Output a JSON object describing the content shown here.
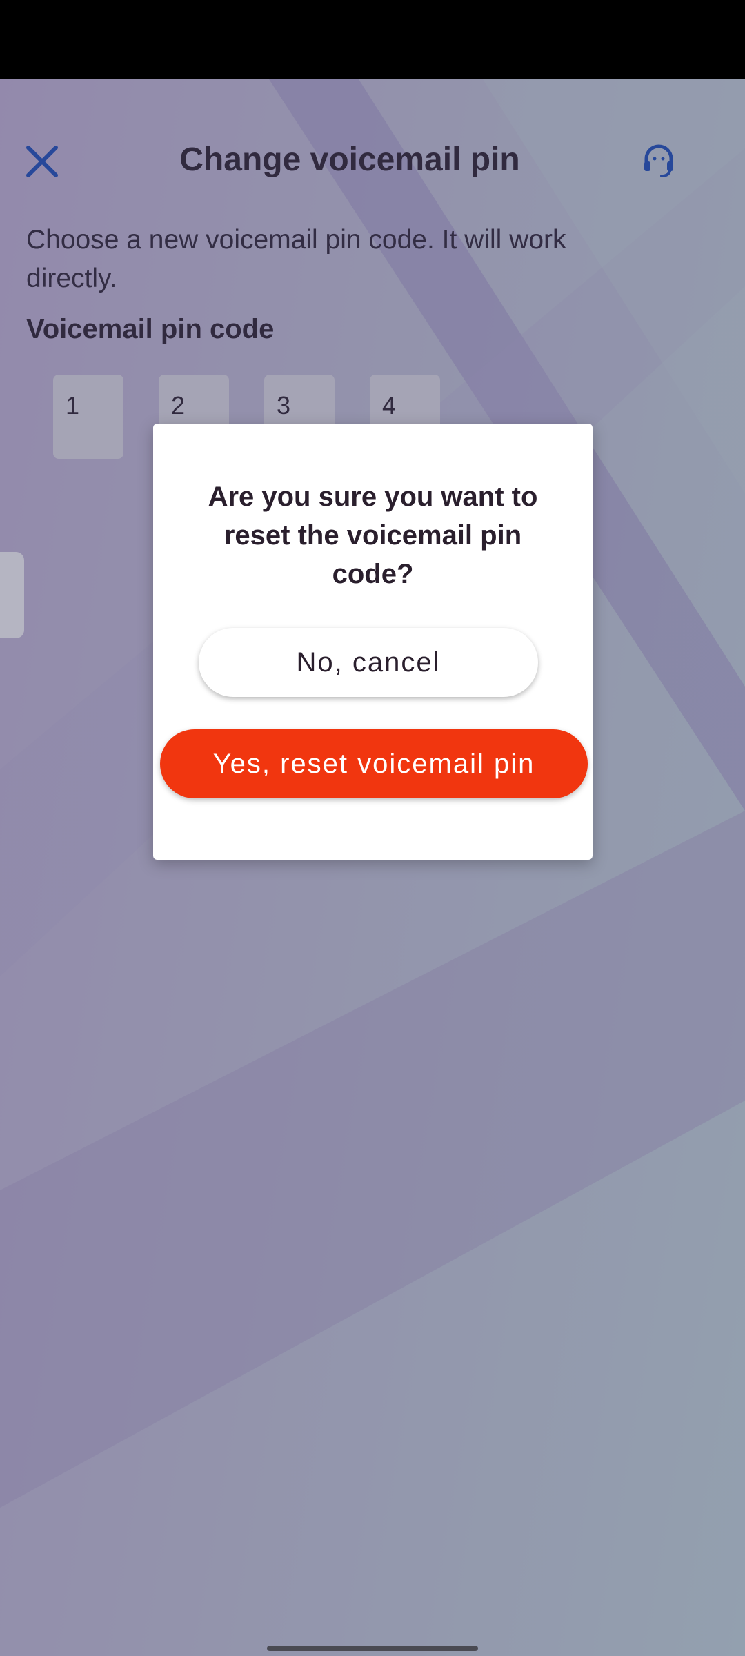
{
  "header": {
    "title": "Change voicemail pin",
    "close_icon": "close-icon",
    "support_icon": "headset-support-icon"
  },
  "content": {
    "intro": "Choose a new voicemail pin code. It will work directly.",
    "pin_label": "Voicemail pin code",
    "pin_digits": [
      "1",
      "2",
      "3",
      "4"
    ]
  },
  "dialog": {
    "message": "Are you sure you want to reset the voicemail pin code?",
    "cancel_label": "No, cancel",
    "confirm_label": "Yes, reset voicemail pin"
  },
  "colors": {
    "accent": "#1a4fbf",
    "danger": "#f1360f",
    "text": "#2a1f2d"
  }
}
